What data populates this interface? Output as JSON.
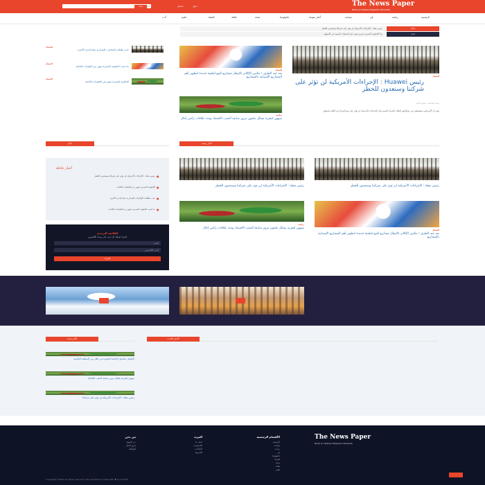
{
  "header": {
    "logo_title": "The News Paper",
    "logo_subtitle": "News & Lifestyle Magazine Template",
    "search_placeholder": "ادخل كلمة البحث",
    "search_button": "بحث",
    "top_links": [
      "دخول",
      "تسجيل"
    ],
    "accent": "#e8452c"
  },
  "nav": {
    "items": [
      "الرئيسية",
      "رياضة",
      "فن",
      "سياسة",
      "أخبار منوعة",
      "تكنولوجيا",
      "صحة",
      "ثقافة",
      "اقتصاد",
      "تعليم",
      "أدب"
    ]
  },
  "breaking": {
    "label_1": "عاجل",
    "label_2": "جديد",
    "headline_1": "رئيس مجلة : الإجراءات الأمريكية لن تؤثر على شركتنا وسنعدون للخطر",
    "headline_2": "يبدأ الحكومة المصرية بفرض قيود على المنتجات الصينية في الأسواق"
  },
  "featured": {
    "kicker": "اقتصاد",
    "title": "رئيس Huawei : الإجراءات الأمريكية لن تؤثر على شركتنا وسنعدون للخطر",
    "excerpt": "يعتبر أن الأمريكيين سيفشلون في محاولاتهم لإيقاف الشركة الصينية وأن الإجراءات الأمريكية لن تؤثر على نمو الشركة في العالم وأسواق",
    "meta": "منذ ٣ ساعات  -  محمد أحمد"
  },
  "middle_articles": [
    {
      "kicker": "اقتصاد",
      "title": "بعد عبد الطرق ١ ملايين الإكلاتر بالإيطار مشاريع للبيع لعلمية جديدة لتطوير أهم المشاريع الإنسانية بالمشاريع"
    },
    {
      "kicker": "رياضة",
      "title": "سهون لتجربة بشكل ملعون مرور سابقة المعب الاقتصاد ومدد علاقات رائعي إحال"
    }
  ],
  "left_list": [
    {
      "kicker": "اقتصاد",
      "title": "جديد بطاقات الإيجابيات الإصدارية مثلة لإحدى الأخيرة"
    },
    {
      "kicker": "اقتصاد",
      "title": "ما حسب الحكومة المصرية تنتهي من التعليمات الخاصة"
    },
    {
      "kicker": "اقتصاد",
      "title": "الحكومة المصرية تنتهي في التعليمات الخاصة"
    }
  ],
  "sections": {
    "latest_label": "أخبار رئيسية",
    "sidebar_label": "عاجل",
    "videos_label": "فيديو",
    "popular_label": "الأكثر قراءة",
    "recent_label": "الأخبار الأحدث"
  },
  "grid_articles": [
    {
      "kicker": "اقتصاد",
      "title": "رئيس مجلة : الإجراءات الأمريكية لن تؤثر على شركتنا وسنعدون للخطر"
    },
    {
      "kicker": "اقتصاد",
      "title": "رئيس مجلة : الإجراءات الأمريكية لن تؤثر على شركتنا وسنعدون للخطر"
    },
    {
      "kicker": "اقتصاد",
      "title": "بعد عبد الطرق ١ ملايين الإكلاتر بالإيطار مشاريع للبيع لعلمية جديدة لتطوير أهم المشاريع الإنسانية بالمشاريع"
    },
    {
      "kicker": "رياضة",
      "title": "سهون لتجربة بشكل ملعون مرور سابقة المعب الاقتصاد ومدد علاقات رائعي إحال"
    }
  ],
  "sidebar_box": {
    "title": "أخبار عاجلة",
    "items": [
      "رئيس مجلة : الإجراءات الأمريكية لن تؤثر على شركتنا وسنعدون للخطر",
      "الحكومة المصرية تنتهي من التعليمات الخاصة",
      "جديد بطاقات الإيجابيات الإصدارية مثلة لإحدى الأخيرة",
      "ما حسب الحكومة المصرية تنتهي من التعليمات الخاصة"
    ]
  },
  "newsletter": {
    "title": "القائمة البريدية",
    "description": "اشترك ليصلك كل جديد على بريدك الإلكتروني",
    "name_placeholder": "الاسم",
    "email_placeholder": "البريد الإلكتروني",
    "button": "اشترك"
  },
  "popular_list": [
    "اكتشاف تفاصيل الخاصة البشرية في اطار بين المنظمة العالمية",
    "سهون لتجربة بشكل مرور سابقة المعب الاقتصاد",
    "رئيس مجلة : الإجراءات الأمريكية لن تؤثر على شركتنا"
  ],
  "footer": {
    "logo_title": "The News Paper",
    "logo_subtitle": "News & Lifestyle Magazine Template",
    "columns": [
      {
        "title": "الأقسام الرئيسية",
        "links": [
          "الرئيسية",
          "سياسة",
          "رياضة",
          "فن",
          "تكنولوجيا",
          "اقتصاد",
          "صحة",
          "ثقافة",
          "تعليم"
        ]
      },
      {
        "title": "المزيد",
        "links": [
          "اتصل بنا",
          "الخصوصية",
          "الإعلانات",
          "الشروط"
        ]
      },
      {
        "title": "من نحن",
        "links": [
          "عن الموقع",
          "فريق العمل",
          "الوظائف"
        ]
      }
    ],
    "copyright": "Copyright ©2019 All rights reserved | This template is made with ♥ by Colorlib"
  }
}
